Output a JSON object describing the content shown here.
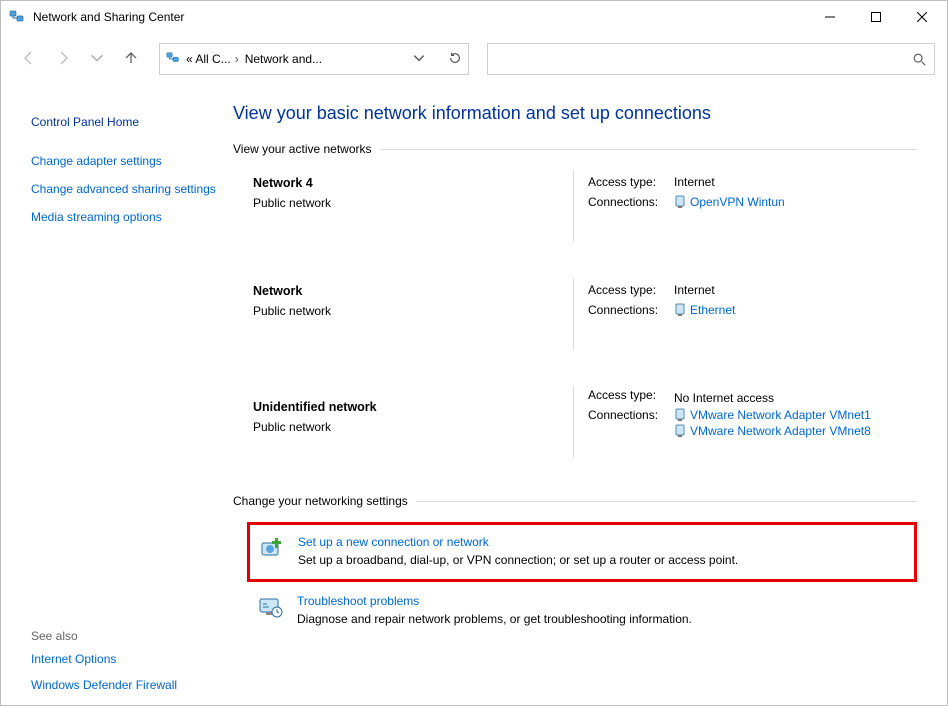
{
  "window": {
    "title": "Network and Sharing Center"
  },
  "toolbar": {
    "breadcrumb_root": "« All C...",
    "breadcrumb_current": "Network and...",
    "search_placeholder": ""
  },
  "sidebar": {
    "home": "Control Panel Home",
    "links": [
      "Change adapter settings",
      "Change advanced sharing settings",
      "Media streaming options"
    ],
    "see_also_label": "See also",
    "see_also": [
      "Internet Options",
      "Windows Defender Firewall"
    ]
  },
  "main": {
    "heading": "View your basic network information and set up connections",
    "active_networks_label": "View your active networks",
    "networks": [
      {
        "name": "Network 4",
        "type": "Public network",
        "access_label": "Access type:",
        "access_value": "Internet",
        "connections_label": "Connections:",
        "connections": [
          "OpenVPN Wintun"
        ]
      },
      {
        "name": "Network",
        "type": "Public network",
        "access_label": "Access type:",
        "access_value": "Internet",
        "connections_label": "Connections:",
        "connections": [
          "Ethernet"
        ]
      },
      {
        "name": "Unidentified network",
        "type": "Public network",
        "access_label": "Access type:",
        "access_value": "No Internet access",
        "connections_label": "Connections:",
        "connections": [
          "VMware Network Adapter VMnet1",
          "VMware Network Adapter VMnet8"
        ]
      }
    ],
    "change_settings_label": "Change your networking settings",
    "settings": [
      {
        "title": "Set up a new connection or network",
        "desc": "Set up a broadband, dial-up, or VPN connection; or set up a router or access point."
      },
      {
        "title": "Troubleshoot problems",
        "desc": "Diagnose and repair network problems, or get troubleshooting information."
      }
    ]
  }
}
